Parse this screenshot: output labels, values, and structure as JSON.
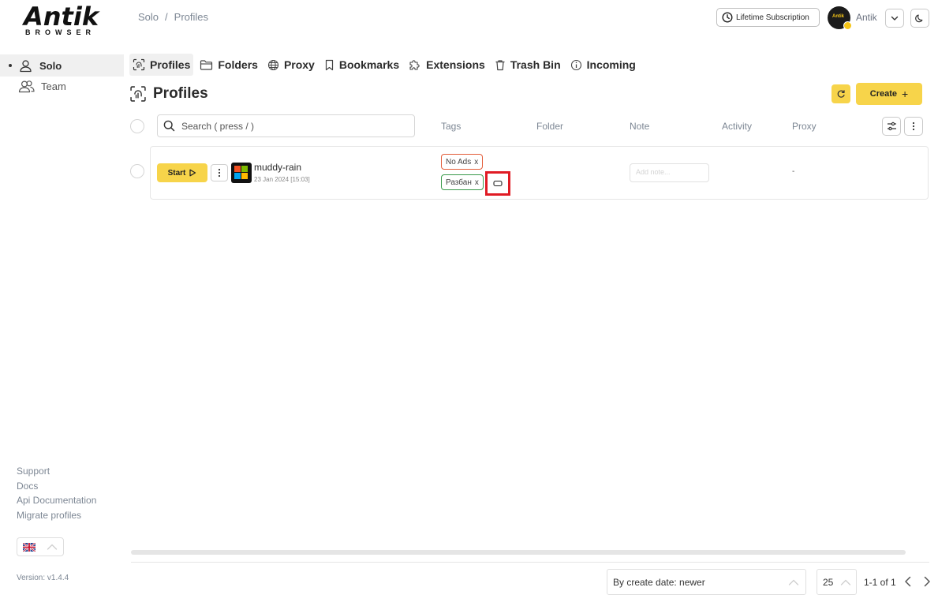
{
  "logo": {
    "word": "Antik",
    "sub": "BROWSER"
  },
  "breadcrumb": {
    "root": "Solo",
    "separator": "/",
    "current": "Profiles"
  },
  "header": {
    "subscription_label": "Lifetime Subscription",
    "avatar_text": "Antik",
    "username": "Antik"
  },
  "sidebar": {
    "items": [
      {
        "label": "Solo",
        "icon": "user-icon",
        "active": true
      },
      {
        "label": "Team",
        "icon": "users-icon",
        "active": false
      }
    ],
    "footer_links": [
      "Support",
      "Docs",
      "Api Documentation",
      "Migrate profiles"
    ],
    "language_flag": "uk-flag-icon",
    "version": "Version: v1.4.4"
  },
  "tabs": [
    {
      "label": "Profiles",
      "icon": "fingerprint-icon",
      "active": true
    },
    {
      "label": "Folders",
      "icon": "folder-icon",
      "active": false
    },
    {
      "label": "Proxy",
      "icon": "globe-icon",
      "active": false
    },
    {
      "label": "Bookmarks",
      "icon": "bookmark-icon",
      "active": false
    },
    {
      "label": "Extensions",
      "icon": "puzzle-icon",
      "active": false
    },
    {
      "label": "Trash Bin",
      "icon": "trash-icon",
      "active": false
    },
    {
      "label": "Incoming",
      "icon": "info-icon",
      "active": false
    }
  ],
  "page": {
    "title": "Profiles",
    "create_label": "Create",
    "create_plus": "+",
    "search_placeholder": "Search ( press / )"
  },
  "columns": {
    "tags": "Tags",
    "folder": "Folder",
    "note": "Note",
    "activity": "Activity",
    "proxy": "Proxy"
  },
  "profiles": [
    {
      "start_label": "Start",
      "name": "muddy-rain",
      "date": "23 Jan 2024 [15:03]",
      "os_icon": "windows-icon",
      "tags": [
        {
          "label": "No Ads",
          "remove": "x",
          "color": "#e35d3a"
        },
        {
          "label": "Разбан",
          "remove": "x",
          "color": "#3a9a4a"
        }
      ],
      "note_placeholder": "Add note...",
      "proxy": "-"
    }
  ],
  "footer": {
    "sort_value": "By create date: newer",
    "per_page": "25",
    "range": "1-1 of 1"
  },
  "colors": {
    "accent": "#f7d44a",
    "highlight_box": "#e01b24"
  }
}
